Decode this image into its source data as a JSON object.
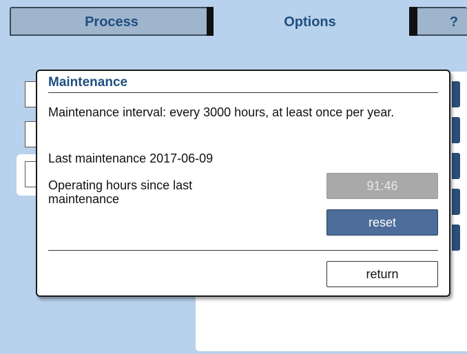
{
  "tabs": {
    "process": "Process",
    "options": "Options",
    "help": "?"
  },
  "dialog": {
    "title": "Maintenance",
    "interval_text": "Maintenance interval: every 3000 hours, at least once per year.",
    "last_maintenance": "Last maintenance 2017-06-09",
    "hours_label": "Operating hours since last maintenance",
    "hours_value": "91:46",
    "reset_label": "reset",
    "return_label": "return"
  },
  "colors": {
    "background": "#b8d1ec",
    "title": "#1f4f7f",
    "reset_button": "#4d6d9a",
    "hours_display": "#a9a9a9"
  }
}
